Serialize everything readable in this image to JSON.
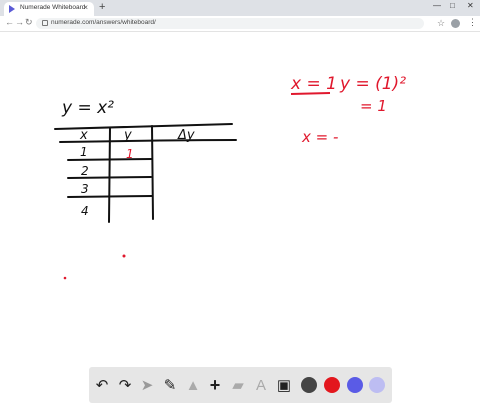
{
  "browser": {
    "tab_title": "Numerade Whiteboard",
    "url": "numerade.com/answers/whiteboard/",
    "icons": [
      "back-arrow-icon",
      "forward-arrow-icon",
      "reload-icon",
      "lock-icon",
      "star-icon",
      "account-icon",
      "menu-icon",
      "new-tab-icon"
    ]
  },
  "whiteboard": {
    "handwriting": {
      "equation": "y = x²",
      "header_x": "x",
      "header_y": "y",
      "header_dy": "Δy",
      "rows": [
        "1",
        "2",
        "3",
        "4"
      ],
      "row1_y": "1",
      "work_x": "x = 1",
      "work_y": "y = (1)²",
      "work_result": "= 1",
      "work_next": "x = -"
    },
    "ink_colors": {
      "black": "#111111",
      "red": "#e0182d"
    }
  },
  "toolbar": {
    "tools": [
      "undo-icon",
      "redo-icon",
      "select-icon",
      "pen-icon",
      "shapes-icon",
      "add-icon",
      "eraser-icon",
      "text-icon",
      "image-icon"
    ],
    "colors": [
      "#444444",
      "#e3171e",
      "#5a5be6",
      "#bdbdf2"
    ]
  }
}
